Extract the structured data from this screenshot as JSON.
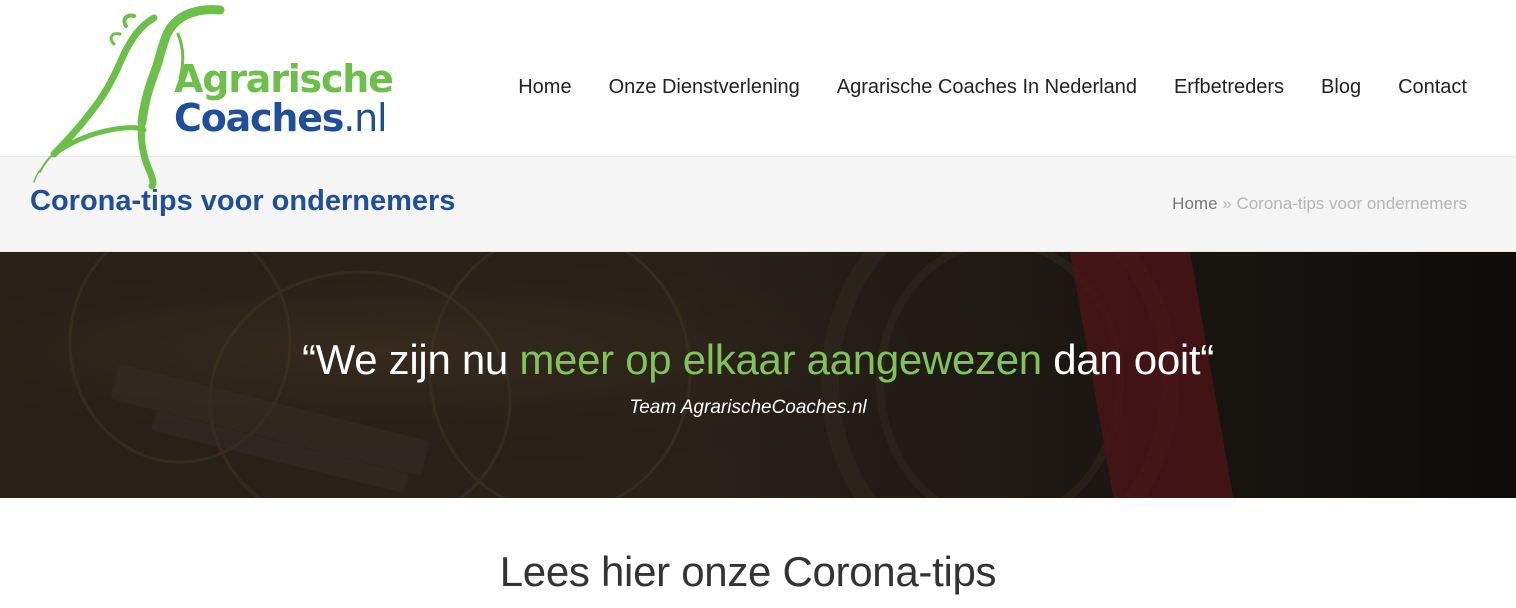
{
  "logo": {
    "line1": "Agrarische",
    "line2_bold": "Coaches",
    "line2_suffix": ".nl",
    "icon": "horse-head-logo-icon"
  },
  "nav": {
    "items": [
      {
        "label": "Home"
      },
      {
        "label": "Onze Dienstverlening"
      },
      {
        "label": "Agrarische Coaches In Nederland"
      },
      {
        "label": "Erfbetreders"
      },
      {
        "label": "Blog"
      },
      {
        "label": "Contact"
      }
    ]
  },
  "titlebar": {
    "title": "Corona-tips voor ondernemers",
    "breadcrumb": {
      "home": "Home",
      "separator": " » ",
      "current": "Corona-tips voor ondernemers"
    }
  },
  "hero": {
    "quote_open": "“We zijn nu ",
    "quote_highlight": "meer op elkaar aangewezen",
    "quote_close": " dan ooit“",
    "author": "Team AgrarischeCoaches.nl"
  },
  "section": {
    "heading": "Lees hier onze Corona-tips"
  },
  "colors": {
    "brand_green": "#6cc04a",
    "brand_blue": "#1f4e9a",
    "highlight_green": "#7fc35b",
    "titlebar_bg": "#f5f5f5"
  }
}
